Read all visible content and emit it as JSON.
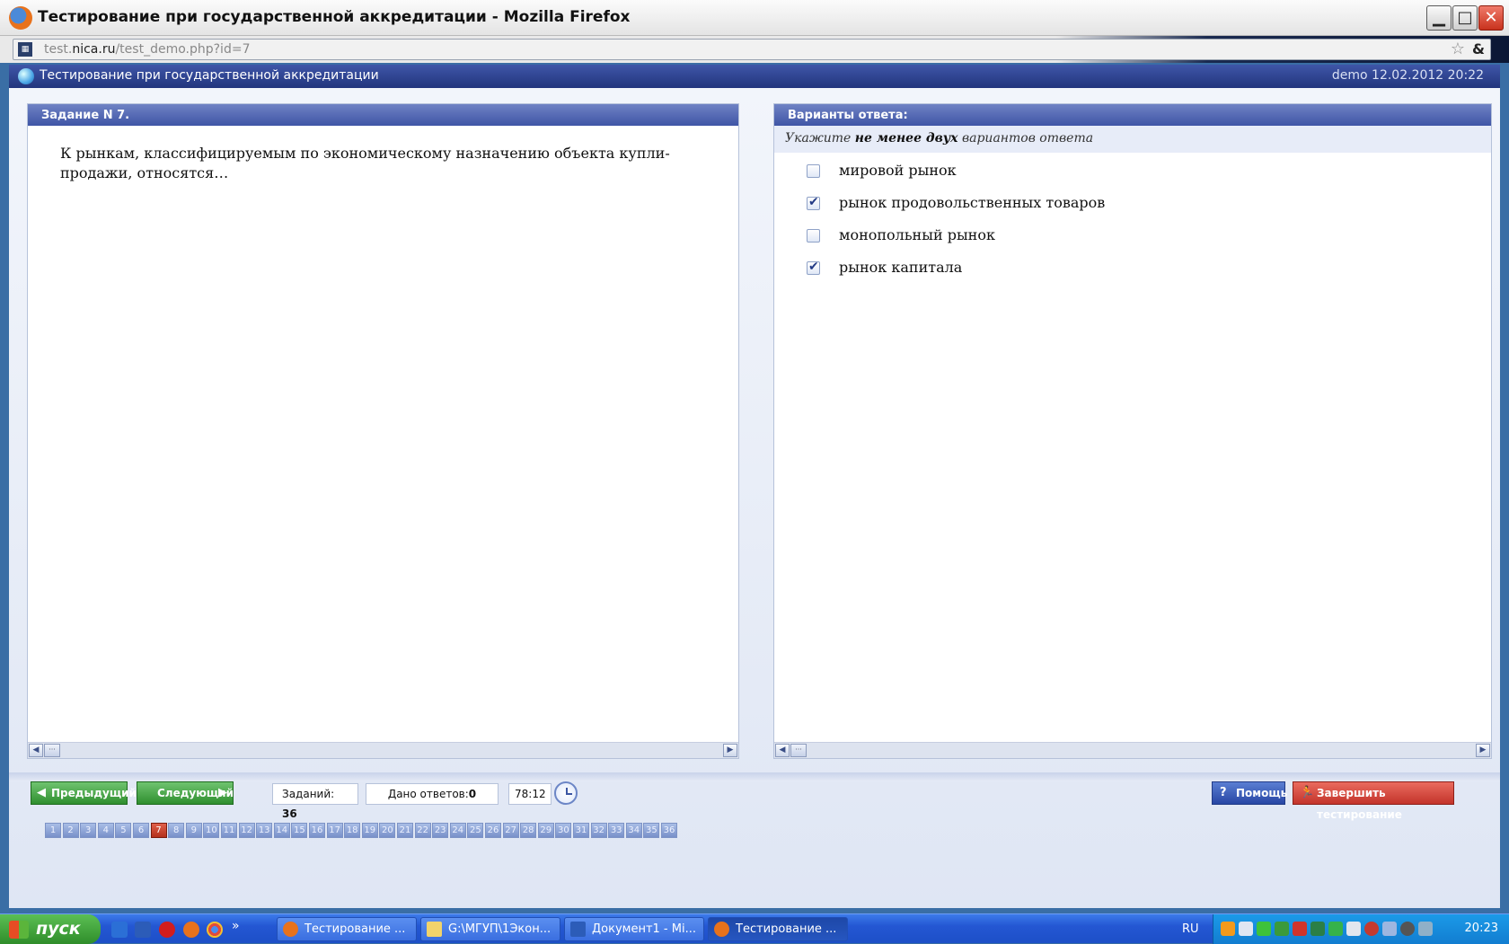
{
  "window": {
    "title": "Тестирование при государственной аккредитации - Mozilla Firefox",
    "minimize": "▁",
    "maximize": "□",
    "close": "✕"
  },
  "address_bar": {
    "url_host": "test.nica.ru",
    "url_path": "/test_demo.php?id=7",
    "url_prefix": "test.",
    "url_host_main": "nica.ru",
    "bookmark_icon": "star-icon"
  },
  "app_header": {
    "title": "Тестирование при государственной аккредитации",
    "user_info": "demo 12.02.2012 20:22"
  },
  "question": {
    "header": "Задание N 7.",
    "text": "К рынкам, классифицируемым по экономическому назначению объекта купли-продажи, относятся…"
  },
  "answers": {
    "header": "Варианты ответа:",
    "hint_before": "Укажите ",
    "hint_bold": "не менее двух",
    "hint_after": " вариантов ответа",
    "options": [
      {
        "label": "мировой рынок",
        "checked": false
      },
      {
        "label": "рынок продовольственных товаров",
        "checked": true
      },
      {
        "label": "монопольный рынок",
        "checked": false
      },
      {
        "label": "рынок капитала",
        "checked": true
      }
    ]
  },
  "nav": {
    "prev_label": "Предыдущий",
    "next_label": "Следующий",
    "tasks_label": "Заданий:",
    "tasks_count": "36",
    "answered_label": "Дано ответов:",
    "answered_count": "0",
    "timer": "78:12",
    "help_label": "Помощь",
    "finish_label": "Завершить тестирование",
    "current_page": 7,
    "pages": [
      "1",
      "2",
      "3",
      "4",
      "5",
      "6",
      "7",
      "8",
      "9",
      "10",
      "11",
      "12",
      "13",
      "14",
      "15",
      "16",
      "17",
      "18",
      "19",
      "20",
      "21",
      "22",
      "23",
      "24",
      "25",
      "26",
      "27",
      "28",
      "29",
      "30",
      "31",
      "32",
      "33",
      "34",
      "35",
      "36"
    ]
  },
  "taskbar": {
    "start_label": "пуск",
    "tasks": [
      {
        "label": "Тестирование ...",
        "icon": "firefox-icon"
      },
      {
        "label": "G:\\МГУП\\1Экон...",
        "icon": "folder-icon"
      },
      {
        "label": "Документ1 - Mi...",
        "icon": "word-icon"
      },
      {
        "label": "Тестирование ...",
        "icon": "firefox-icon"
      }
    ],
    "lang": "RU",
    "clock": "20:23"
  },
  "colors": {
    "header_blue": "#2b3f8c",
    "panel_head": "#5065b3",
    "current_page_red": "#c23a26",
    "nav_green": "#3aa53a",
    "help_blue": "#2d4ea5",
    "finish_red": "#d2403a"
  }
}
